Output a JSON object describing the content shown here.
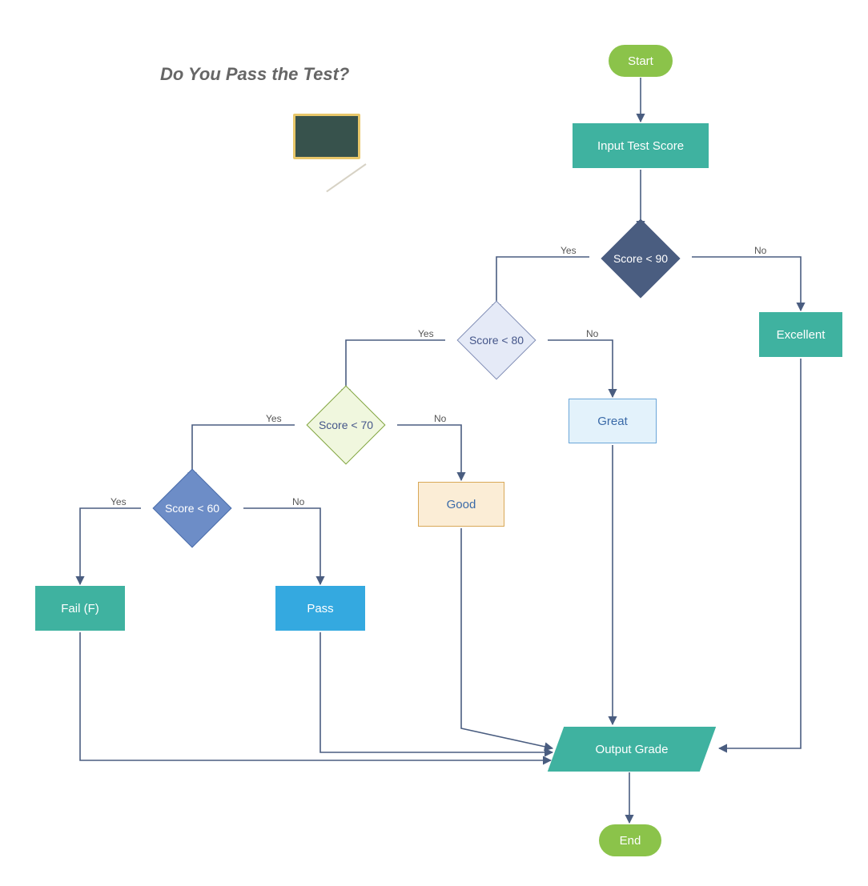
{
  "title": "Do You Pass the Test?",
  "nodes": {
    "start": "Start",
    "input": "Input Test Score",
    "d90": "Score < 90",
    "d80": "Score < 80",
    "d70": "Score < 70",
    "d60": "Score < 60",
    "excellent": "Excellent",
    "great": "Great",
    "good": "Good",
    "pass": "Pass",
    "fail": "Fail (F)",
    "output": "Output Grade",
    "end": "End"
  },
  "labels": {
    "yes": "Yes",
    "no": "No"
  },
  "flow": {
    "description": "Flowchart grading a test score",
    "start": "start",
    "end": "end",
    "decisions": [
      {
        "id": "d90",
        "condition": "Score < 90",
        "yes_to": "d80",
        "no_to": "excellent"
      },
      {
        "id": "d80",
        "condition": "Score < 80",
        "yes_to": "d70",
        "no_to": "great"
      },
      {
        "id": "d70",
        "condition": "Score < 70",
        "yes_to": "d60",
        "no_to": "good"
      },
      {
        "id": "d60",
        "condition": "Score < 60",
        "yes_to": "fail",
        "no_to": "pass"
      }
    ],
    "outcomes_merge_into": "output",
    "sequence": [
      "start",
      "input",
      "d90",
      "output",
      "end"
    ]
  }
}
